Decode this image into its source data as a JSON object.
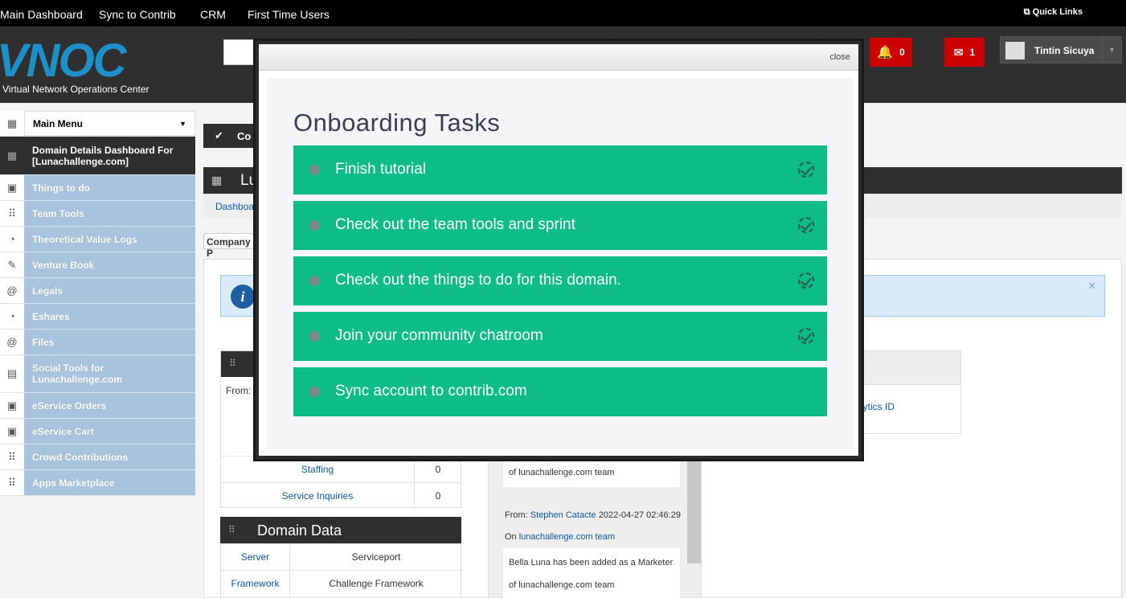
{
  "topnav": {
    "items": [
      "Main Dashboard",
      "Sync to Contrib",
      "CRM",
      "First Time Users"
    ],
    "quick_links": "Quick Links"
  },
  "header": {
    "logo_text": "VNOC",
    "logo_subtitle": "Virtual Network Operations Center",
    "notifications_count": "0",
    "messages_count": "1",
    "user_name": "Tintin Sicuya"
  },
  "sidebar": {
    "main_menu": "Main Menu",
    "items": [
      {
        "label": "Domain Details Dashboard For [Lunachallenge.com]",
        "icon": "dashboard-icon"
      },
      {
        "label": "Things to do",
        "icon": "calendar-icon"
      },
      {
        "label": "Team Tools",
        "icon": "grid-icon"
      },
      {
        "label": "Theoretical Value Logs",
        "icon": "pie-icon"
      },
      {
        "label": "Venture Book",
        "icon": "pencil-icon"
      },
      {
        "label": "Legals",
        "icon": "at-icon"
      },
      {
        "label": "Eshares",
        "icon": "pie-icon"
      },
      {
        "label": "Files",
        "icon": "at-icon"
      },
      {
        "label": "Social Tools for Lunachallenge.com",
        "icon": "image-icon"
      },
      {
        "label": "eService Orders",
        "icon": "calendar-icon"
      },
      {
        "label": "eService Cart",
        "icon": "calendar-icon"
      },
      {
        "label": "Crowd Contributions",
        "icon": "grid-icon"
      },
      {
        "label": "Apps Marketplace",
        "icon": "grid-icon"
      }
    ]
  },
  "background": {
    "compact_button": "Co",
    "domain_title": "Lu",
    "breadcrumb": "Dashboa",
    "company_tab": "Company P",
    "from_label": "From:",
    "counts_table": [
      {
        "label": "Staffing",
        "value": "0"
      },
      {
        "label": "Service Inquiries",
        "value": "0"
      }
    ],
    "domain_data_title": "Domain Data",
    "domain_data": [
      {
        "key": "Server",
        "value": "Serviceport"
      },
      {
        "key": "Framework",
        "value": "Challenge Framework"
      }
    ],
    "analytics_link": "lytics ID",
    "messages": [
      {
        "body_end": "of lunachallenge.com team"
      },
      {
        "from_label": "From:",
        "from": "Stephen Catacte",
        "date": "2022-04-27 02:46:29",
        "on_label": "On",
        "team": "lunachallenge.com team",
        "body_1": "Bella Luna has been added as a Marketer",
        "body_2": "of lunachallenge.com team"
      }
    ]
  },
  "modal": {
    "close_label": "close",
    "title": "Onboarding Tasks",
    "tasks": [
      "Finish tutorial",
      "Check out the team tools and sprint",
      "Check out the things to do for this domain.",
      "Join your community chatroom",
      "Sync account to contrib.com"
    ]
  },
  "colors": {
    "task_green": "#0dbc86",
    "alert_red": "#cc0000",
    "sidebar_blue": "#a7c3de",
    "header_dark": "#2f2f2f"
  }
}
